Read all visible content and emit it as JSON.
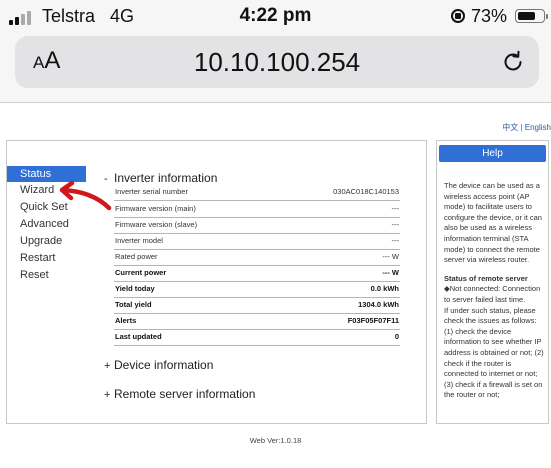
{
  "status_bar": {
    "carrier": "Telstra",
    "network": "4G",
    "time": "4:22 pm",
    "battery": "73%",
    "battery_level": 0.73
  },
  "browser": {
    "text_size_label_small": "A",
    "text_size_label_large": "A",
    "url": "10.10.100.254"
  },
  "languages": [
    "中文",
    "English"
  ],
  "menu": [
    {
      "label": "Status",
      "active": true
    },
    {
      "label": "Wizard"
    },
    {
      "label": "Quick Set"
    },
    {
      "label": "Advanced"
    },
    {
      "label": "Upgrade"
    },
    {
      "label": "Restart"
    },
    {
      "label": "Reset"
    }
  ],
  "sections": {
    "inverter": {
      "toggle": "-",
      "title": "Inverter information",
      "rows": [
        {
          "label": "Inverter serial number",
          "value": "030AC018C140153"
        },
        {
          "label": "Firmware version (main)",
          "value": "---"
        },
        {
          "label": "Firmware version (slave)",
          "value": "---"
        },
        {
          "label": "Inverter model",
          "value": "---"
        },
        {
          "label": "Rated power",
          "value": "--- W"
        },
        {
          "label": "Current power",
          "value": "--- W"
        },
        {
          "label": "Yield today",
          "value": "0.0 kWh"
        },
        {
          "label": "Total yield",
          "value": "1304.0 kWh"
        },
        {
          "label": "Alerts",
          "value": "F03F05F07F11"
        },
        {
          "label": "Last updated",
          "value": "0"
        }
      ]
    },
    "device": {
      "toggle": "+",
      "title": "Device information"
    },
    "remote": {
      "toggle": "+",
      "title": "Remote server information"
    }
  },
  "help": {
    "title": "Help",
    "intro": "The device can be used as a wireless access point (AP mode) to facilitate users to configure the device, or it can also be used as a wireless information terminal (STA mode) to connect the remote server via wireless router.",
    "remote_heading": "Status of remote server",
    "remote_text": "◆Not connected: Connection to server failed last time.",
    "remote_more": "If under such status, please check the issues as follows: (1) check the device information to see whether IP address is obtained or not; (2) check if the router is connected to internet or not; (3) check if a firewall is set on the router or not;"
  },
  "footer": "Web Ver:1.0.18",
  "colors": {
    "accent": "#2f6fd6",
    "annotation": "#d01818",
    "lang_link": "#2c5aa0"
  }
}
